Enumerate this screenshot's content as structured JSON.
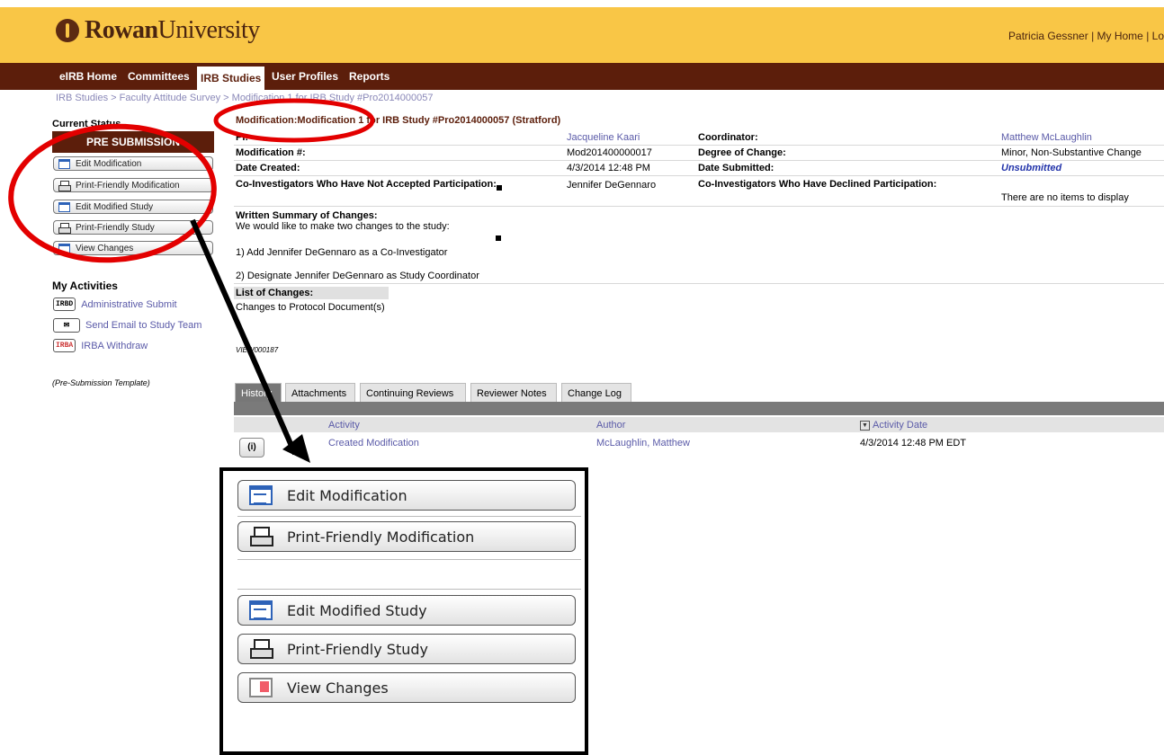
{
  "header": {
    "logo_text": "Rowan",
    "logo_text_2": "University",
    "user_links": "Patricia Gessner | My Home | Lo"
  },
  "nav": {
    "items": [
      "eIRB Home",
      "Committees",
      "IRB Studies",
      "User Profiles",
      "Reports"
    ],
    "active": "IRB Studies"
  },
  "breadcrumb": "IRB Studies  >  Faculty Attitude Survey  >  Modification 1 for IRB Study #Pro2014000057",
  "sidebar": {
    "current_status_label": "Current Status",
    "status": "PRE SUBMISSION",
    "buttons": [
      "Edit Modification",
      "Print-Friendly Modification",
      "Edit Modified Study",
      "Print-Friendly Study",
      "View Changes"
    ],
    "my_activities_label": "My Activities",
    "activities": [
      {
        "tag": "IRBD",
        "label": "Administrative Submit"
      },
      {
        "tag": "✉",
        "label": "Send Email to Study Team"
      },
      {
        "tag": "IRBA",
        "label": "IRBA Withdraw"
      }
    ],
    "template_note": "(Pre-Submission Template)"
  },
  "main": {
    "title": "Modification:Modification 1 for IRB Study #Pro2014000057 (Stratford)",
    "pi_label": "PI:",
    "pi_value": "Jacqueline Kaari",
    "coordinator_label": "Coordinator:",
    "coordinator_value": "Matthew McLaughlin",
    "mod_num_label": "Modification #:",
    "mod_num_value": "Mod201400000017",
    "degree_label": "Degree of Change:",
    "degree_value": "Minor, Non-Substantive Change",
    "date_created_label": "Date Created:",
    "date_created_value": "4/3/2014 12:48 PM",
    "date_submitted_label": "Date Submitted:",
    "date_submitted_value": "Unsubmitted",
    "coinv_not_accepted_label": "Co-Investigators Who Have Not Accepted Participation:",
    "coinv_not_accepted_value": "Jennifer DeGennaro",
    "coinv_declined_label": "Co-Investigators Who Have Declined Participation:",
    "coinv_declined_value": "There are no items to display",
    "summary_label": "Written Summary of Changes",
    "summary_lines": [
      "We would like to make two changes to the study:",
      "1) Add Jennifer DeGennaro as a Co-Investigator",
      "2) Designate Jennifer DeGennaro as Study Coordinator"
    ],
    "list_changes_label": "List of Changes",
    "list_changes_value": "Changes to Protocol Document(s)",
    "view_id": "VIEW000187"
  },
  "tabs": [
    "History",
    "Attachments",
    "Continuing Reviews",
    "Reviewer Notes",
    "Change Log"
  ],
  "history_table": {
    "columns": [
      "Activity",
      "Author",
      "Activity Date"
    ],
    "rows": [
      {
        "activity": "Created Modification",
        "author": "McLaughlin, Matthew",
        "date": "4/3/2014 12:48 PM EDT"
      }
    ]
  },
  "zoom_panel": {
    "buttons": [
      "Edit Modification",
      "Print-Friendly Modification",
      "Edit Modified Study",
      "Print-Friendly Study",
      "View Changes"
    ]
  },
  "colors": {
    "header_bg": "#f9c646",
    "nav_bg": "#5c1e0b",
    "highlight_red": "#e30000"
  }
}
